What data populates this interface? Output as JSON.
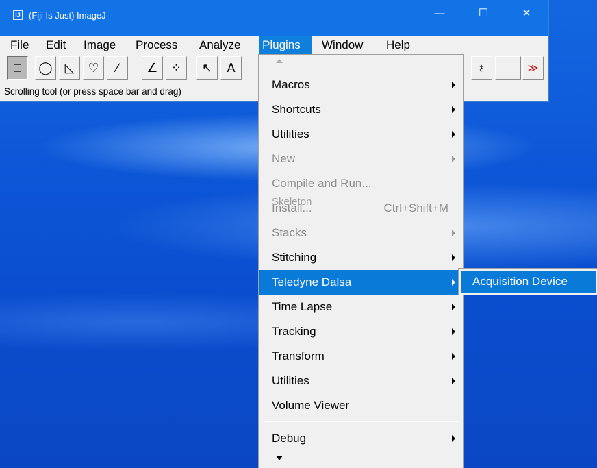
{
  "window": {
    "title": "(Fiji Is Just) ImageJ",
    "icon": "fiji-icon",
    "minimize": "—",
    "maximize": "☐",
    "close": "✕"
  },
  "menubar": {
    "items": [
      "File",
      "Edit",
      "Image",
      "Process",
      "Analyze",
      "Plugins",
      "Window",
      "Help"
    ],
    "active": "Plugins"
  },
  "toolbar": {
    "tools": [
      {
        "icon": "rectangle-tool-icon",
        "glyph": "□"
      },
      {
        "icon": "oval-tool-icon",
        "glyph": "◯"
      },
      {
        "icon": "polygon-tool-icon",
        "glyph": "◺"
      },
      {
        "icon": "freehand-tool-icon",
        "glyph": "♡"
      },
      {
        "icon": "line-tool-icon",
        "glyph": "∕"
      },
      {
        "icon": "angle-tool-icon",
        "glyph": "∠"
      },
      {
        "icon": "point-tool-icon",
        "glyph": "⁘"
      },
      {
        "icon": "wand-tool-icon",
        "glyph": "↖"
      },
      {
        "icon": "text-tool-icon",
        "glyph": "A"
      }
    ],
    "right_tools": [
      {
        "icon": "dropper-tool-icon",
        "glyph": "♁"
      },
      {
        "icon": "blank-tool-icon",
        "glyph": ""
      },
      {
        "icon": "more-tools-icon",
        "glyph": "≫"
      }
    ]
  },
  "status": "Scrolling tool (or press space bar and drag)",
  "plugins_menu": {
    "items": [
      {
        "label": "Macros",
        "submenu": true,
        "disabled": false
      },
      {
        "label": "Shortcuts",
        "submenu": true,
        "disabled": false
      },
      {
        "label": "Utilities",
        "submenu": true,
        "disabled": false
      },
      {
        "label": "New",
        "submenu": true,
        "disabled": true
      },
      {
        "label": "Compile and Run...",
        "submenu": false,
        "disabled": true
      },
      {
        "label": "Install...",
        "submenu": false,
        "disabled": true,
        "shortcut": "Ctrl+Shift+M",
        "ghost": "Skeleton"
      },
      {
        "label": "Stacks",
        "submenu": true,
        "disabled": true
      },
      {
        "label": "Stitching",
        "submenu": true,
        "disabled": false
      },
      {
        "label": "Teledyne Dalsa",
        "submenu": true,
        "disabled": false,
        "selected": true
      },
      {
        "label": "Time Lapse",
        "submenu": true,
        "disabled": false
      },
      {
        "label": "Tracking",
        "submenu": true,
        "disabled": false
      },
      {
        "label": "Transform",
        "submenu": true,
        "disabled": false
      },
      {
        "label": "Utilities",
        "submenu": true,
        "disabled": false
      },
      {
        "label": "Volume Viewer",
        "submenu": false,
        "disabled": false
      }
    ],
    "after_separator": [
      {
        "label": "Debug",
        "submenu": true,
        "disabled": false
      }
    ]
  },
  "submenu": {
    "item": "Acquisition Device"
  }
}
